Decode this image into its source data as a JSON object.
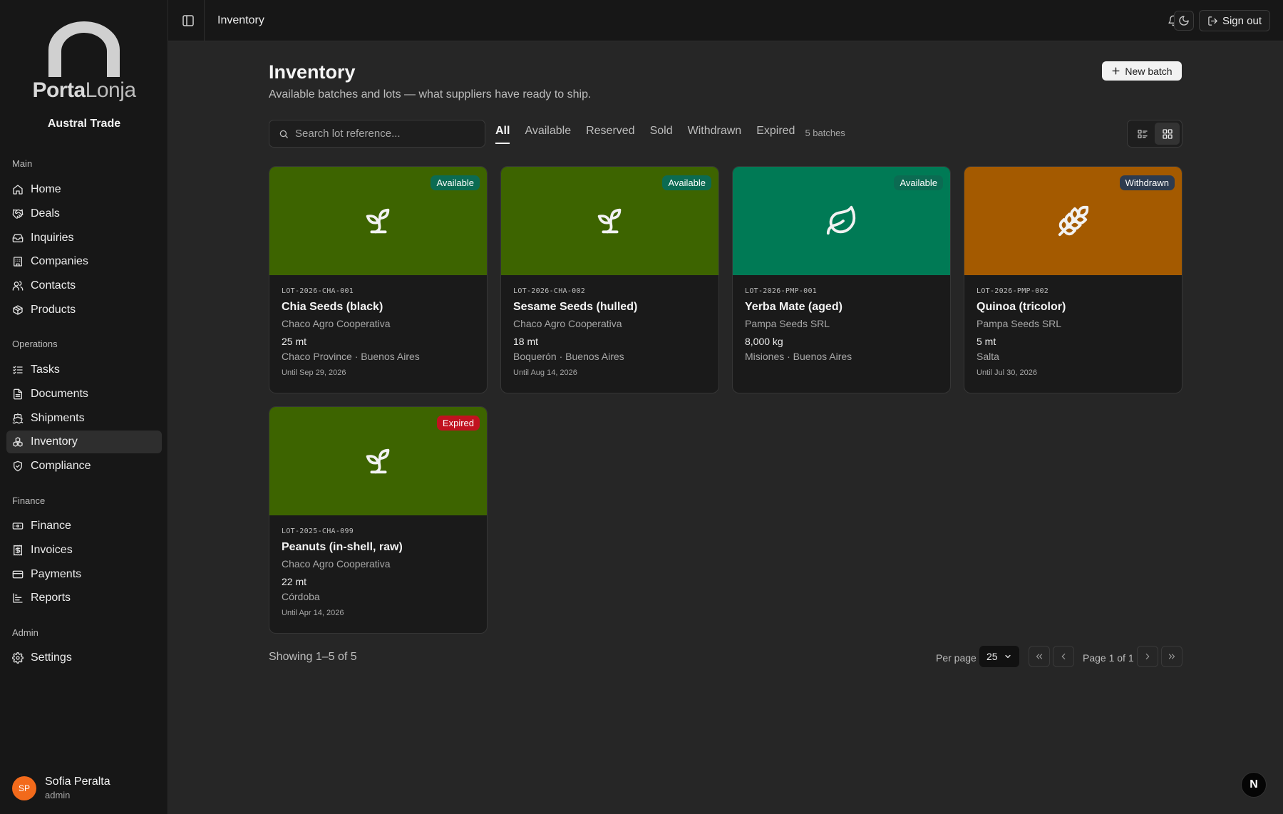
{
  "brand": {
    "logo_bold": "Porta",
    "logo_light": "Lonja",
    "org_name": "Austral Trade"
  },
  "sidebar": {
    "groups": [
      {
        "title": "Main",
        "items": [
          {
            "label": "Home",
            "icon": "home-icon"
          },
          {
            "label": "Deals",
            "icon": "handshake-icon"
          },
          {
            "label": "Inquiries",
            "icon": "inbox-icon"
          },
          {
            "label": "Companies",
            "icon": "building-icon"
          },
          {
            "label": "Contacts",
            "icon": "users-icon"
          },
          {
            "label": "Products",
            "icon": "package-icon"
          }
        ]
      },
      {
        "title": "Operations",
        "items": [
          {
            "label": "Tasks",
            "icon": "list-checks-icon"
          },
          {
            "label": "Documents",
            "icon": "file-icon"
          },
          {
            "label": "Shipments",
            "icon": "ship-icon"
          },
          {
            "label": "Inventory",
            "icon": "boxes-icon",
            "active": true
          },
          {
            "label": "Compliance",
            "icon": "shield-check-icon"
          }
        ]
      },
      {
        "title": "Finance",
        "items": [
          {
            "label": "Finance",
            "icon": "banknote-icon"
          },
          {
            "label": "Invoices",
            "icon": "receipt-icon"
          },
          {
            "label": "Payments",
            "icon": "credit-card-icon"
          },
          {
            "label": "Reports",
            "icon": "bar-chart-icon"
          }
        ]
      },
      {
        "title": "Admin",
        "items": [
          {
            "label": "Settings",
            "icon": "gear-icon"
          }
        ]
      }
    ]
  },
  "user": {
    "initials": "SP",
    "name": "Sofia Peralta",
    "role": "admin"
  },
  "header": {
    "title": "Inventory",
    "signout_label": "Sign out"
  },
  "page": {
    "title": "Inventory",
    "subtitle": "Available batches and lots — what suppliers have ready to ship.",
    "new_batch_label": "New batch"
  },
  "search": {
    "placeholder": "Search lot reference..."
  },
  "tabs": [
    "All",
    "Available",
    "Reserved",
    "Sold",
    "Withdrawn",
    "Expired"
  ],
  "active_tab": "All",
  "batch_count": "5 batches",
  "cards": [
    {
      "lot": "LOT-2026-CHA-001",
      "product": "Chia Seeds (black)",
      "supplier": "Chaco Agro Cooperativa",
      "qty": "25 mt",
      "location": "Chaco Province · Buenos Aires",
      "until": "Until Sep 29, 2026",
      "status": "Available",
      "bg": "#3d6400",
      "badge_bg": "#0b6b52",
      "icon": "sprout-icon"
    },
    {
      "lot": "LOT-2026-CHA-002",
      "product": "Sesame Seeds (hulled)",
      "supplier": "Chaco Agro Cooperativa",
      "qty": "18 mt",
      "location": "Boquerón · Buenos Aires",
      "until": "Until Aug 14, 2026",
      "status": "Available",
      "bg": "#3d6400",
      "badge_bg": "#0b6b52",
      "icon": "sprout-icon"
    },
    {
      "lot": "LOT-2026-PMP-001",
      "product": "Yerba Mate (aged)",
      "supplier": "Pampa Seeds SRL",
      "qty": "8,000 kg",
      "location": "Misiones · Buenos Aires",
      "until": "",
      "status": "Available",
      "bg": "#007a55",
      "badge_bg": "#0b6b52",
      "icon": "leaf-icon"
    },
    {
      "lot": "LOT-2026-PMP-002",
      "product": "Quinoa (tricolor)",
      "supplier": "Pampa Seeds SRL",
      "qty": "5 mt",
      "location": "Salta",
      "until": "Until Jul 30, 2026",
      "status": "Withdrawn",
      "bg": "#a45a00",
      "badge_bg": "#2d3b4f",
      "icon": "wheat-icon"
    },
    {
      "lot": "LOT-2025-CHA-099",
      "product": "Peanuts (in-shell, raw)",
      "supplier": "Chaco Agro Cooperativa",
      "qty": "22 mt",
      "location": "Córdoba",
      "until": "Until Apr 14, 2026",
      "status": "Expired",
      "bg": "#3d6400",
      "badge_bg": "#c1121f",
      "icon": "sprout-icon"
    }
  ],
  "footer": {
    "showing": "Showing 1–5 of 5",
    "per_page_label": "Per page",
    "per_page_value": "25",
    "page_info": "Page 1 of 1"
  },
  "floating_badge": "N"
}
